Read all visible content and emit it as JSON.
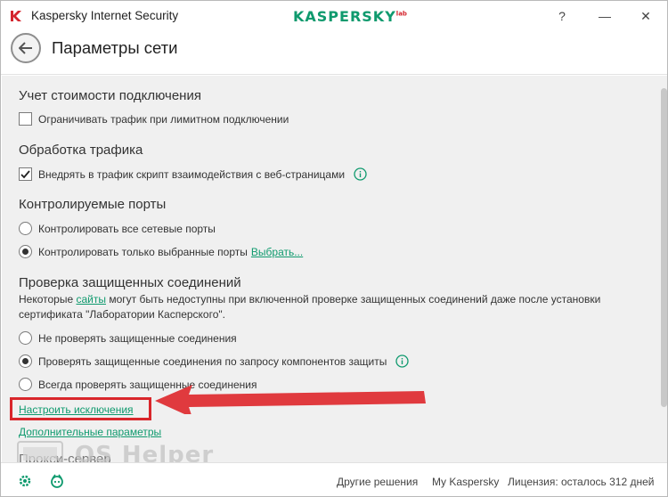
{
  "window": {
    "title": "Kaspersky Internet Security",
    "brand": "KASPERSKY",
    "brand_sup": "lab",
    "help": "?",
    "minimize": "—",
    "close": "✕"
  },
  "header": {
    "title": "Параметры сети"
  },
  "sections": {
    "cost": {
      "title": "Учет стоимости подключения",
      "limit_traffic": {
        "label": "Ограничивать трафик при лимитном подключении",
        "checked": false
      }
    },
    "traffic": {
      "title": "Обработка трафика",
      "inject_script": {
        "label": "Внедрять в трафик скрипт взаимодействия с веб-страницами",
        "checked": true
      }
    },
    "ports": {
      "title": "Контролируемые порты",
      "all_ports": {
        "label": "Контролировать все сетевые порты",
        "selected": false
      },
      "selected_ports": {
        "label": "Контролировать только выбранные порты",
        "selected": true
      },
      "select_link": "Выбрать..."
    },
    "secure": {
      "title": "Проверка защищенных соединений",
      "desc_before": "Некоторые ",
      "desc_link": "сайты",
      "desc_after": " могут быть недоступны при включенной проверке защищенных соединений даже после установки сертификата \"Лаборатории Касперского\".",
      "options": [
        {
          "label": "Не проверять защищенные соединения",
          "selected": false
        },
        {
          "label": "Проверять защищенные соединения по запросу компонентов защиты",
          "selected": true
        },
        {
          "label": "Всегда проверять защищенные соединения",
          "selected": false
        }
      ]
    }
  },
  "links": {
    "exceptions": "Настроить исключения",
    "advanced": "Дополнительные параметры"
  },
  "proxy_title": "Прокси-сервер",
  "watermark": "OS Helper",
  "footer": {
    "other_solutions": "Другие решения",
    "my_kaspersky": "My Kaspersky",
    "license": "Лицензия: осталось 312 дней"
  },
  "colors": {
    "accent": "#0f9a6e",
    "highlight": "#d9262b",
    "content_bg": "#f0f0f0"
  }
}
